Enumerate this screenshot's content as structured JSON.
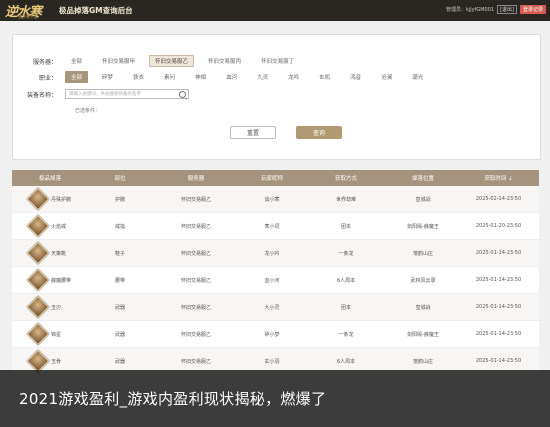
{
  "topbar": {
    "logo_text": "逆水寒",
    "logo_sub": "逆水寒手游",
    "title": "极品掉落GM查询后台",
    "user_label": "管理员：kjjyfGM001",
    "logout_label": "[退出]",
    "login_label": "登录记录"
  },
  "filters": {
    "server": {
      "label": "服务器：",
      "options": [
        "全部",
        "怀旧交易服甲",
        "怀旧交易服乙",
        "怀旧交易服丙",
        "怀旧交易服丁"
      ],
      "selected_index": 2
    },
    "profession": {
      "label": "职业：",
      "options": [
        "全部",
        "碎梦",
        "铁衣",
        "素问",
        "神相",
        "血河",
        "九灵",
        "龙吟",
        "玄机",
        "鸿音",
        "沧澜",
        "潮光"
      ],
      "selected_index": 0
    },
    "equipment": {
      "label": "装备名称：",
      "placeholder": "请输入关键词，共总搜索装备的名字"
    },
    "selected_conditions": "已选条件：",
    "reset_label": "重置",
    "query_label": "查询"
  },
  "table": {
    "columns": [
      "极品掉落",
      "部位",
      "服务器",
      "玩家昵称",
      "获取方式",
      "掉落位置",
      "获取时间 ↓"
    ],
    "rows": [
      {
        "name": "丹殊护腕",
        "slot": "护腕",
        "server": "怀旧交易服乙",
        "player": "谈小寒",
        "method": "世界劫难",
        "location": "皇城战",
        "time": "2025-02-14-23:50"
      },
      {
        "name": "火焰戒",
        "slot": "戒指",
        "server": "怀旧交易服乙",
        "player": "寒小词",
        "method": "团本",
        "location": "剑阳殿-薛魔王",
        "time": "2025-01-20-23:50"
      },
      {
        "name": "天策靴",
        "slot": "鞋子",
        "server": "怀旧交易服乙",
        "player": "龙小吟",
        "method": "一条龙",
        "location": "落鹤山庄",
        "time": "2025-01-14-23:50"
      },
      {
        "name": "薛魔腰带",
        "slot": "腰带",
        "server": "怀旧交易服乙",
        "player": "血小河",
        "method": "6人周本",
        "location": "武林风云录",
        "time": "2025-01-14-23:50"
      },
      {
        "name": "玉刃",
        "slot": "武器",
        "server": "怀旧交易服乙",
        "player": "九小灵",
        "method": "团本",
        "location": "皇城战",
        "time": "2025-01-14-23:50"
      },
      {
        "name": "锦星",
        "slot": "武器",
        "server": "怀旧交易服乙",
        "player": "碎小梦",
        "method": "一条龙",
        "location": "剑阳殿-薛魔王",
        "time": "2025-01-14-23:50"
      },
      {
        "name": "玉骨",
        "slot": "武器",
        "server": "怀旧交易服乙",
        "player": "玄小羽",
        "method": "6人周本",
        "location": "落鹤山庄",
        "time": "2025-01-14-23:50"
      }
    ]
  },
  "caption": "2021游戏盈利_游戏内盈利现状揭秘，燃爆了"
}
